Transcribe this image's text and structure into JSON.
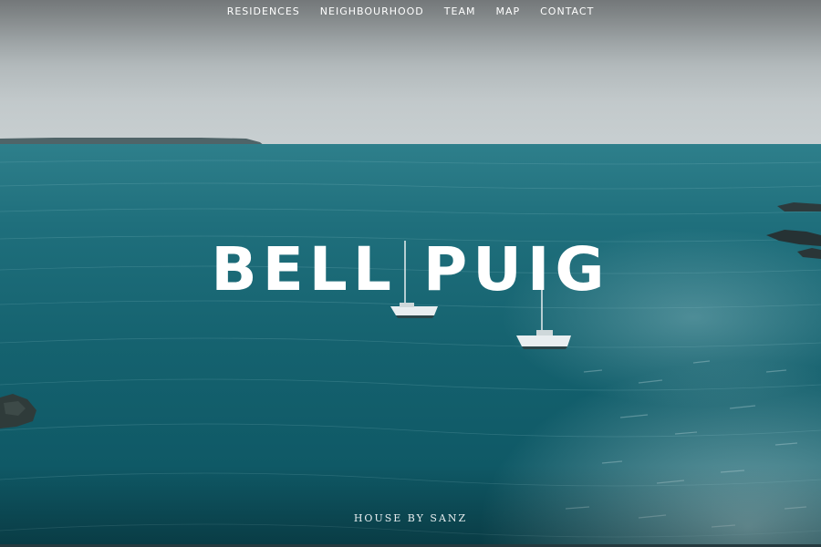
{
  "nav": {
    "items": [
      {
        "label": "RESIDENCES"
      },
      {
        "label": "NEIGHBOURHOOD"
      },
      {
        "label": "TEAM"
      },
      {
        "label": "MAP"
      },
      {
        "label": "CONTACT"
      }
    ]
  },
  "hero": {
    "title": "BELL PUIG",
    "tagline": "HOUSE BY SANZ"
  },
  "colors": {
    "sea": "#15626f",
    "sky": "#c2c9cb",
    "text": "#ffffff"
  }
}
